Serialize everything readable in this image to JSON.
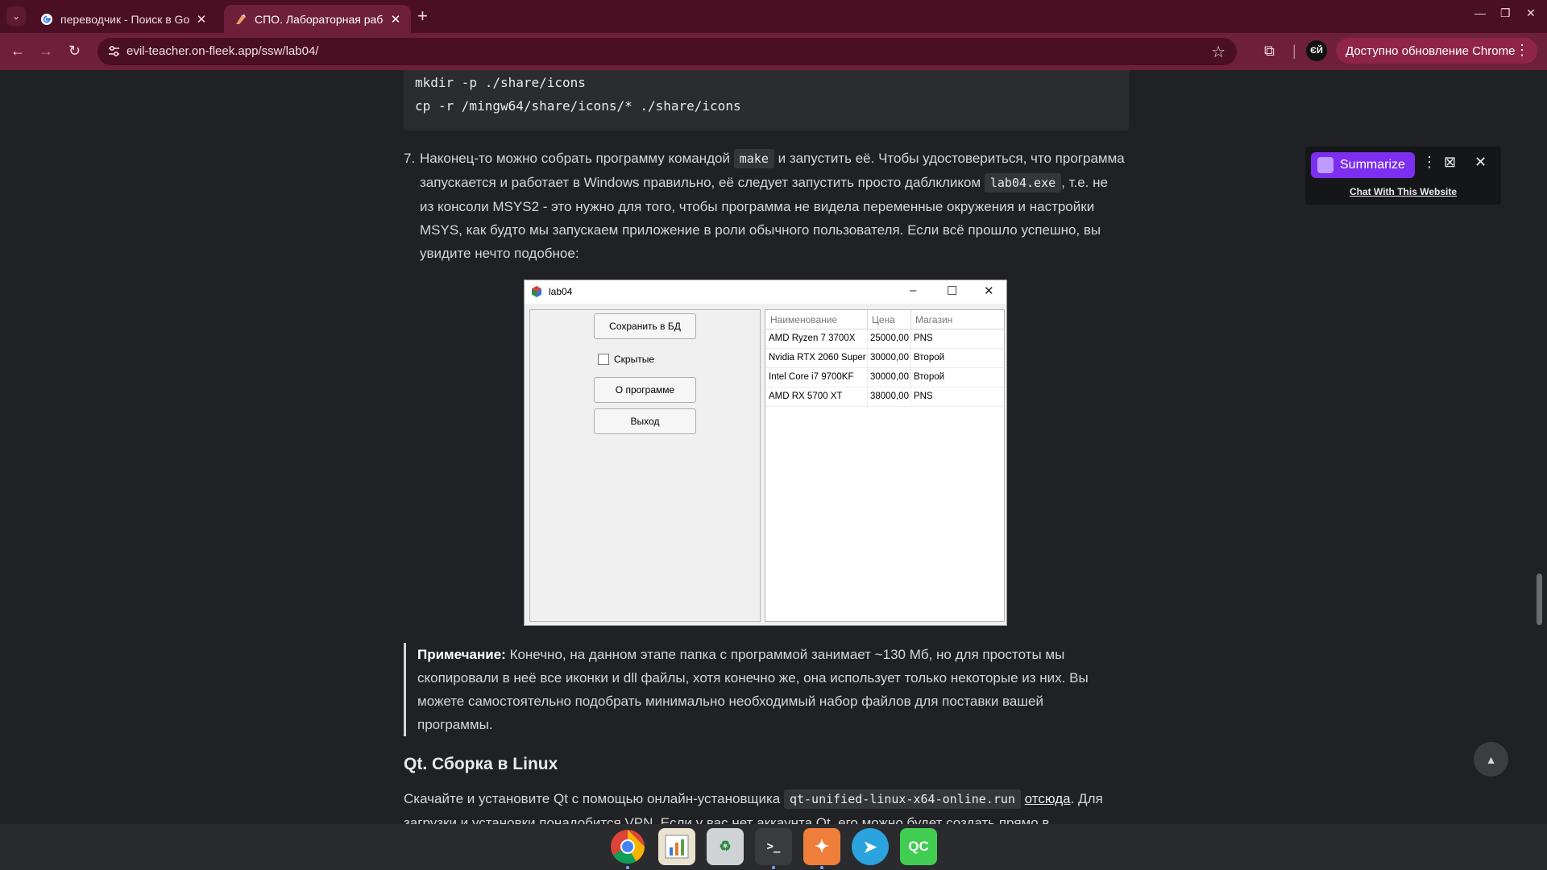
{
  "browser": {
    "tabs": [
      {
        "title": "переводчик - Поиск в Goog",
        "favicon": "google-icon",
        "active": false
      },
      {
        "title": "СПО. Лабораторная работа",
        "favicon": "site-icon",
        "active": true
      }
    ],
    "url": "evil-teacher.on-fleek.app/ssw/lab04/",
    "update_label": "Доступно обновление Chrome",
    "profile_initials": "ЄЙ",
    "theme_color": "#6e1f3a"
  },
  "article": {
    "code_lines": [
      "mkdir -p ./share/icons",
      "cp -r /mingw64/share/icons/* ./share/icons"
    ],
    "step7": {
      "number": "7.",
      "t1": "Наконец-то можно собрать программу командой",
      "c1": "make",
      "t2": "и запустить её. Чтобы удостовериться, что программа",
      "t3": "запускается и работает в Windows правильно, её следует запустить просто даблкликом",
      "c2": "lab04.exe",
      "t4": ", т.е. не",
      "line3": "из консоли MSYS2 - это нужно для того, чтобы программа не видела переменные окружения и настройки",
      "line4": "MSYS, как будто мы запускаем приложение в роли обычного пользователя. Если всё прошло успешно, вы",
      "line5": "увидите нечто подобное:"
    },
    "note": {
      "label": "Примечание:",
      "l1": "Конечно, на данном этапе папка с программой занимает ~130 Мб, но для простоты мы",
      "l2": "скопировали в неё все иконки и dll файлы, хотя конечно же, она использует только некоторые из них. Вы",
      "l3": "можете самостоятельно подобрать минимально необходимый набор файлов для поставки вашей",
      "l4": "программы."
    },
    "heading": "Qt. Сборка в Linux",
    "last": {
      "t1": "Скачайте и установите Qt с помощью онлайн-установщика",
      "code": "qt-unified-linux-x64-online.run",
      "link": "отсюда",
      "t2": ". Для",
      "line2": "загрузки и установки понадобится VPN. Если у вас нет аккаунта Qt, его можно будет создать прямо в"
    }
  },
  "qt_window": {
    "title": "lab04",
    "buttons": {
      "save": "Сохранить в БД",
      "about": "О программе",
      "exit": "Выход"
    },
    "checkbox_label": "Скрытые",
    "checkbox_checked": false,
    "columns": [
      "Наименование",
      "Цена",
      "Магазин"
    ],
    "rows": [
      [
        "AMD Ryzen 7 3700X",
        "25000,00",
        "PNS"
      ],
      [
        "Nvidia RTX 2060 Super",
        "30000,00",
        "Второй"
      ],
      [
        "Intel Core i7 9700KF",
        "30000,00",
        "Второй"
      ],
      [
        "AMD RX 5700 XT",
        "38000,00",
        "PNS"
      ]
    ]
  },
  "summarize": {
    "button_label": "Summarize",
    "chat_link": "Chat With This Website",
    "accent": "#7c2ff0"
  },
  "taskbar": {
    "apps": [
      "chrome-icon",
      "spreadsheet-icon",
      "trash-icon",
      "terminal-icon",
      "app-icon",
      "telegram-icon",
      "qtcreator-icon"
    ],
    "qtcreator_label": "QC"
  }
}
